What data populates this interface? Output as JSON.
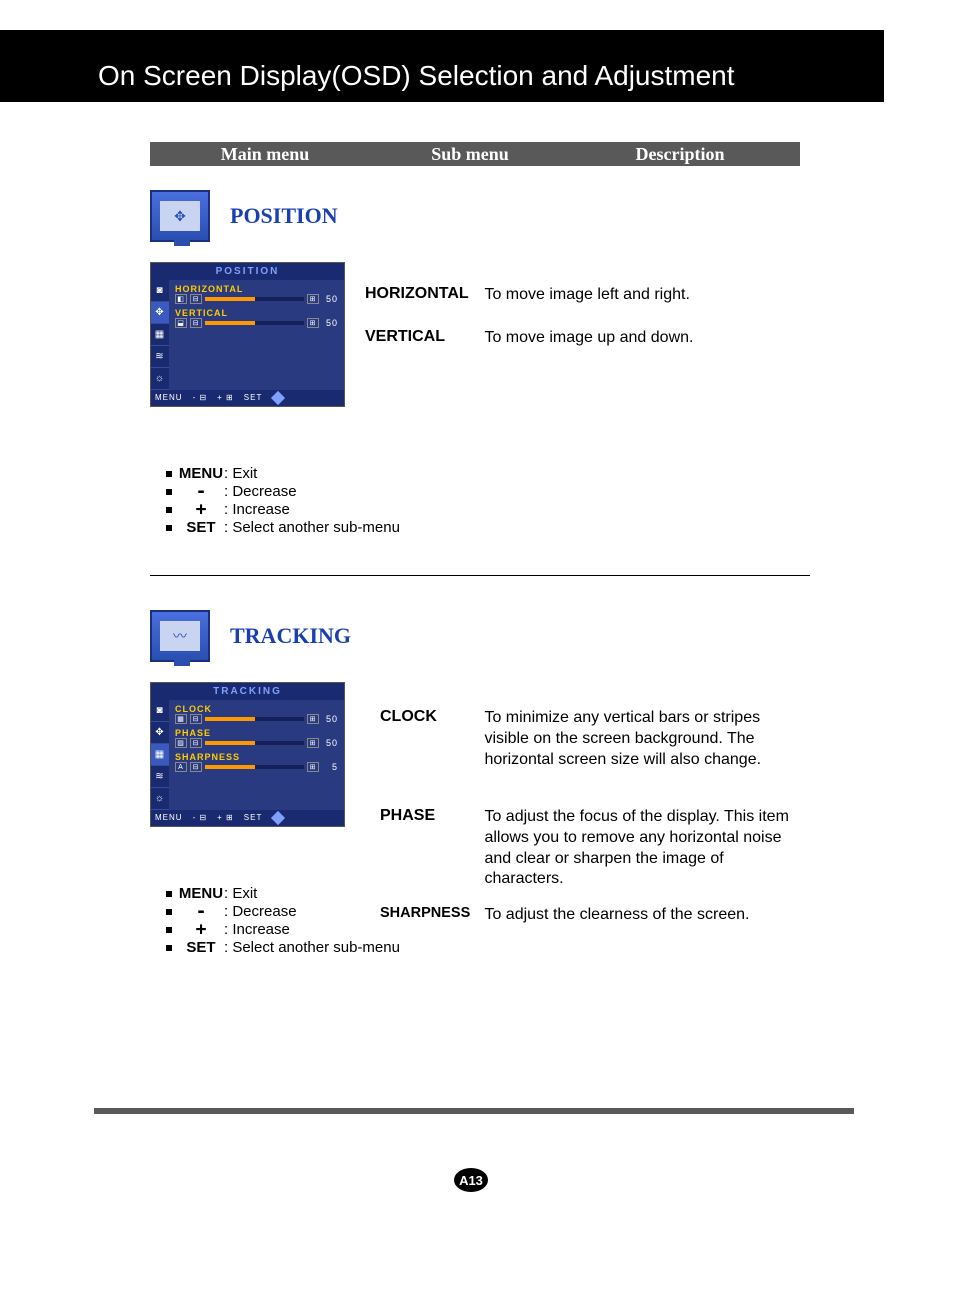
{
  "page_title": "On Screen Display(OSD) Selection and Adjustment",
  "headers": {
    "main": "Main menu",
    "sub": "Sub menu",
    "desc": "Description"
  },
  "sections": [
    {
      "title": "POSITION",
      "osd_title": "POSITION",
      "osd_items": [
        {
          "label": "HORIZONTAL",
          "value": "50",
          "fill": 50
        },
        {
          "label": "VERTICAL",
          "value": "50",
          "fill": 50
        }
      ],
      "subs": [
        {
          "label": "HORIZONTAL",
          "desc": "To move image left and right."
        },
        {
          "label": "VERTICAL",
          "desc": "To move image up and down."
        }
      ]
    },
    {
      "title": "TRACKING",
      "osd_title": "TRACKING",
      "osd_items": [
        {
          "label": "CLOCK",
          "value": "50",
          "fill": 50
        },
        {
          "label": "PHASE",
          "value": "50",
          "fill": 50
        },
        {
          "label": "SHARPNESS",
          "value": "5",
          "fill": 50
        }
      ],
      "subs": [
        {
          "label": "CLOCK",
          "desc": "To minimize any vertical bars or stripes visible on the screen background. The horizontal screen size will also change."
        },
        {
          "label": "PHASE",
          "desc": "To adjust the focus of the display. This item allows you to remove any horizontal noise and clear or sharpen the image of characters."
        },
        {
          "label": "SHARPNESS",
          "desc": "To adjust the clearness of the screen."
        }
      ]
    }
  ],
  "legend": [
    {
      "key": "MENU",
      "text": ": Exit"
    },
    {
      "key": "-",
      "text": ": Decrease"
    },
    {
      "key": "+",
      "text": ": Increase"
    },
    {
      "key": "SET",
      "text": ": Select another sub-menu"
    }
  ],
  "osd_footer": {
    "menu": "MENU",
    "set": "SET"
  },
  "page_num": "A13"
}
